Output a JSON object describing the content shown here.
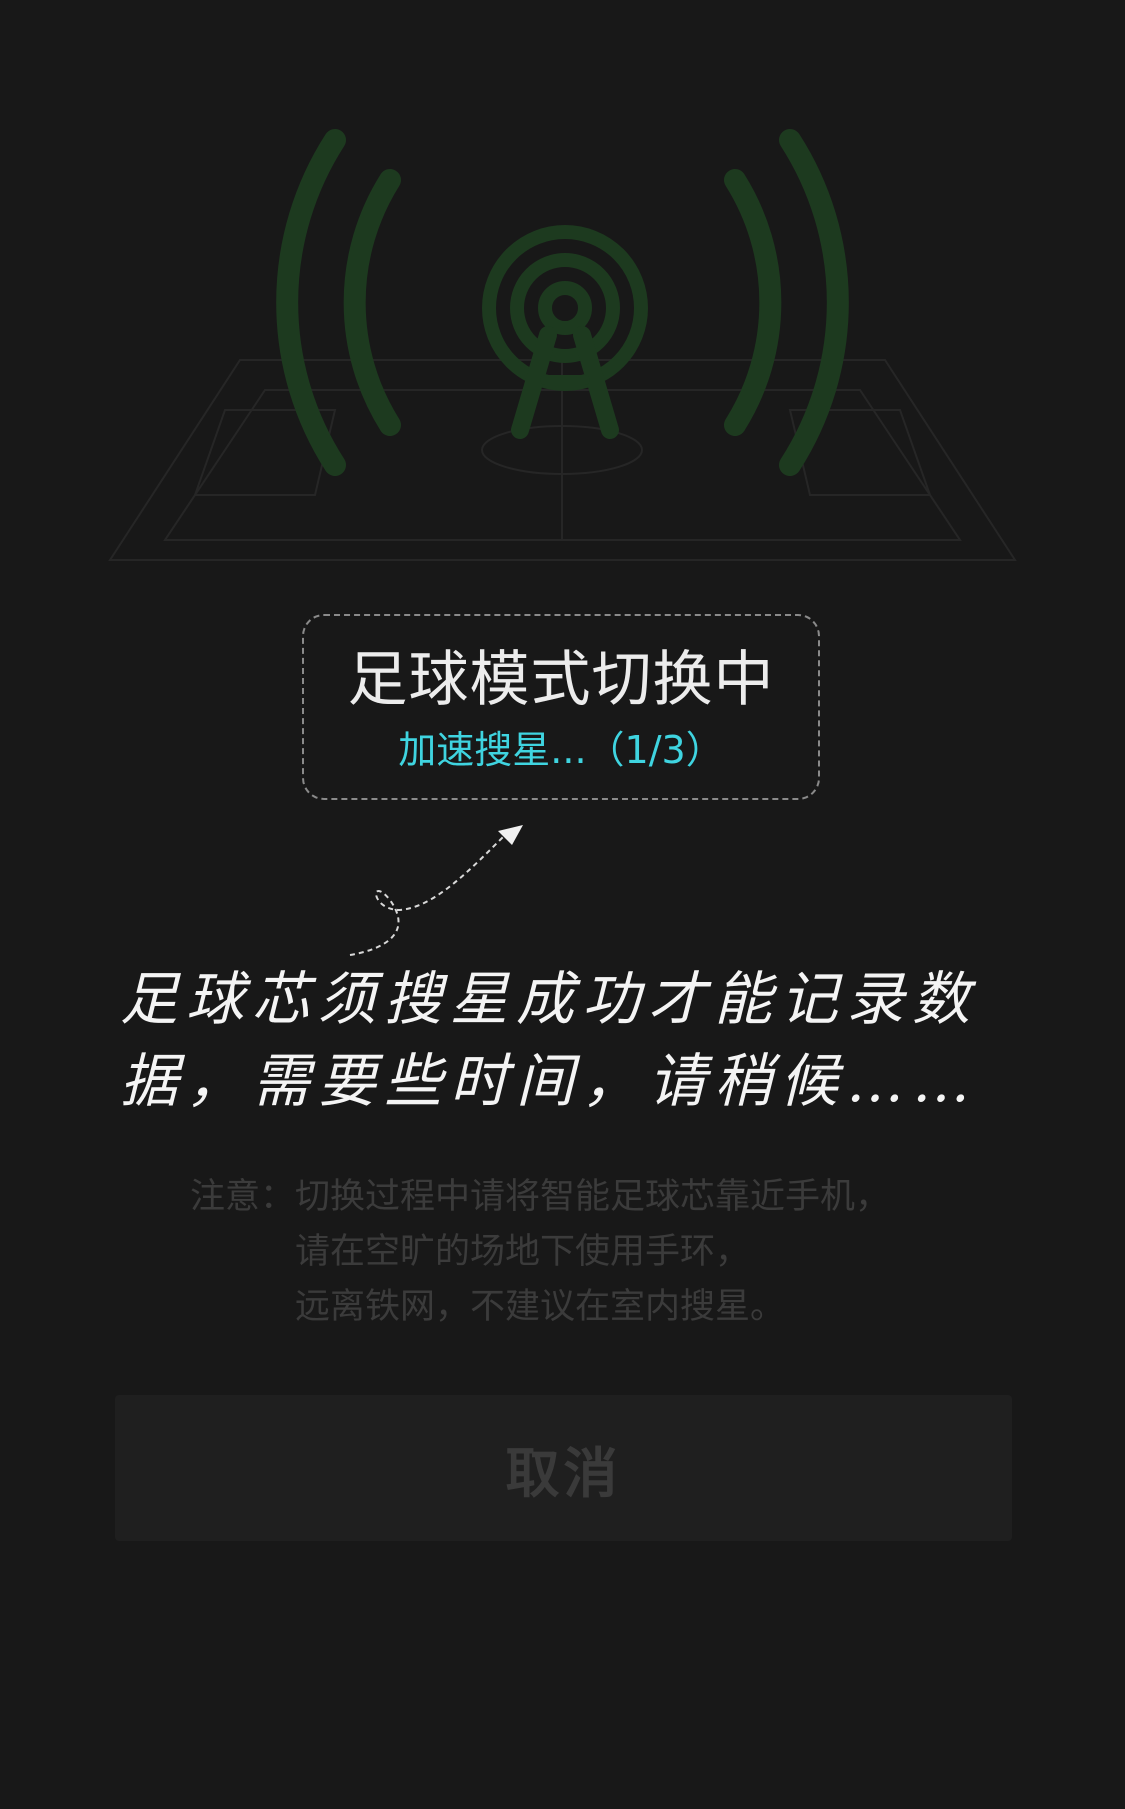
{
  "status": {
    "title": "足球模式切换中",
    "subtitle": "加速搜星...（1/3）"
  },
  "hint": {
    "line1": "足球芯须搜星成功才能记录数",
    "line2": "据，需要些时间，请稍候……"
  },
  "note": {
    "label": "注意：",
    "lines": [
      "切换过程中请将智能足球芯靠近手机，",
      "请在空旷的场地下使用手环，",
      "远离铁网，不建议在室内搜星。"
    ]
  },
  "actions": {
    "cancel_label": "取消"
  },
  "colors": {
    "background": "#181818",
    "accent_cyan": "#3fd4e0",
    "signal_green": "#1d3a1f",
    "field_lines": "#262626"
  },
  "icons": {
    "signal_tower": "signal-tower-icon",
    "arrow": "curly-arrow-icon"
  }
}
